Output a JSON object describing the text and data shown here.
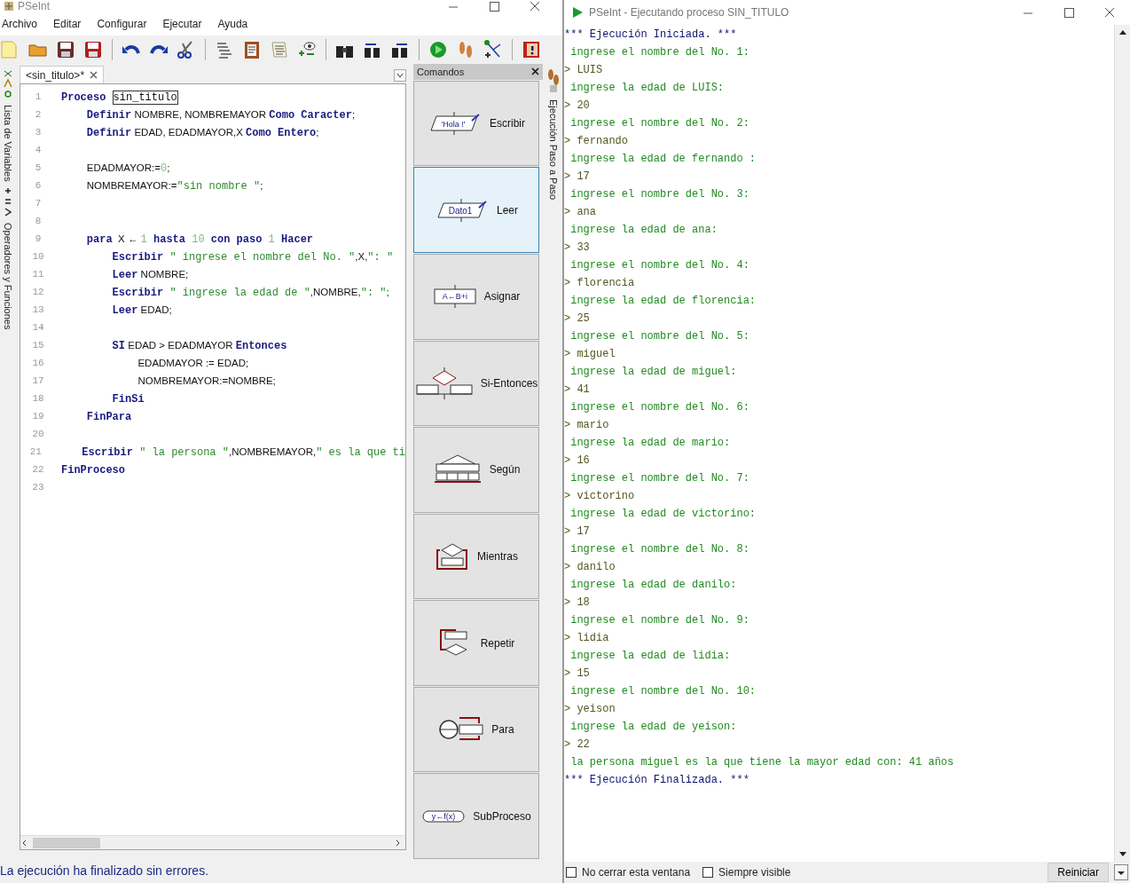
{
  "editor_window": {
    "title": "PSeInt",
    "menu": [
      "Archivo",
      "Editar",
      "Configurar",
      "Ejecutar",
      "Ayuda"
    ],
    "side_panel": [
      {
        "label": "Lista de Variables",
        "kind": "vars"
      },
      {
        "label": "Operadores y Funciones",
        "kind": "ops"
      }
    ],
    "tabs": [
      {
        "label": "<sin_titulo>*",
        "selected": true
      }
    ],
    "code_lines": [
      {
        "number": "1",
        "tokens": [
          {
            "text": "Proceso ",
            "kind": "kw"
          },
          {
            "text": "sin_titulo",
            "kind": "name"
          }
        ]
      },
      {
        "number": "2",
        "tokens": [
          {
            "text": "    Definir",
            "kind": "kw"
          },
          {
            "text": " NOMBRE, NOMBREMAYOR ",
            "kind": "id"
          },
          {
            "text": "Como Caracter",
            "kind": "kw"
          },
          {
            "text": ";",
            "kind": "id"
          }
        ]
      },
      {
        "number": "3",
        "tokens": [
          {
            "text": "    Definir",
            "kind": "kw"
          },
          {
            "text": " EDAD, EDADMAYOR,X ",
            "kind": "id"
          },
          {
            "text": "Como Entero",
            "kind": "kw"
          },
          {
            "text": ";",
            "kind": "id"
          }
        ]
      },
      {
        "number": "4"
      },
      {
        "number": "5",
        "tokens": [
          {
            "text": "    EDADMAYOR:=",
            "kind": "id"
          },
          {
            "text": "0",
            "kind": "num"
          },
          {
            "text": ";",
            "kind": "id"
          }
        ]
      },
      {
        "number": "6",
        "tokens": [
          {
            "text": "    NOMBREMAYOR:=",
            "kind": "id"
          },
          {
            "text": "\"sin nombre \"",
            "kind": "str"
          },
          {
            "text": ";",
            "kind": "id"
          }
        ]
      },
      {
        "number": "7"
      },
      {
        "number": "8"
      },
      {
        "number": "9",
        "tokens": [
          {
            "text": "    para",
            "kind": "kw"
          },
          {
            "text": "  X ← ",
            "kind": "id"
          },
          {
            "text": "1 ",
            "kind": "num"
          },
          {
            "text": "hasta",
            "kind": "kw"
          },
          {
            "text": " 10 ",
            "kind": "num"
          },
          {
            "text": "con paso",
            "kind": "kw"
          },
          {
            "text": " 1 ",
            "kind": "num"
          },
          {
            "text": "Hacer",
            "kind": "kw"
          }
        ]
      },
      {
        "number": "10",
        "tokens": [
          {
            "text": "        Escribir",
            "kind": "kw"
          },
          {
            "text": " \" ingrese el nombre del No. \"",
            "kind": "str"
          },
          {
            "text": ",X,",
            "kind": "id"
          },
          {
            "text": "\": \"",
            "kind": "str"
          }
        ]
      },
      {
        "number": "11",
        "tokens": [
          {
            "text": "        Leer",
            "kind": "kw"
          },
          {
            "text": " NOMBRE;",
            "kind": "id"
          }
        ]
      },
      {
        "number": "12",
        "tokens": [
          {
            "text": "        Escribir",
            "kind": "kw"
          },
          {
            "text": " \" ingrese la edad de \"",
            "kind": "str"
          },
          {
            "text": ",NOMBRE,",
            "kind": "id"
          },
          {
            "text": "\": \"",
            "kind": "str"
          },
          {
            "text": ";",
            "kind": "id"
          }
        ]
      },
      {
        "number": "13",
        "tokens": [
          {
            "text": "        Leer",
            "kind": "kw"
          },
          {
            "text": " EDAD;",
            "kind": "id"
          }
        ]
      },
      {
        "number": "14"
      },
      {
        "number": "15",
        "tokens": [
          {
            "text": "        SI",
            "kind": "kw"
          },
          {
            "text": " EDAD > EDADMAYOR ",
            "kind": "id"
          },
          {
            "text": "Entonces",
            "kind": "kw"
          }
        ]
      },
      {
        "number": "16",
        "tokens": [
          {
            "text": "            EDADMAYOR := EDAD;",
            "kind": "id"
          }
        ]
      },
      {
        "number": "17",
        "tokens": [
          {
            "text": "            NOMBREMAYOR:=NOMBRE;",
            "kind": "id"
          }
        ]
      },
      {
        "number": "18",
        "tokens": [
          {
            "text": "        FinSi",
            "kind": "kw"
          }
        ]
      },
      {
        "number": "19",
        "tokens": [
          {
            "text": "    FinPara",
            "kind": "kw"
          }
        ]
      },
      {
        "number": "20"
      },
      {
        "number": "21",
        "tokens": [
          {
            "text": "    Escribir",
            "kind": "kw"
          },
          {
            "text": " \" la persona \"",
            "kind": "str"
          },
          {
            "text": ",NOMBREMAYOR,",
            "kind": "id"
          },
          {
            "text": "\" es la que ti",
            "kind": "str"
          }
        ]
      },
      {
        "number": "22",
        "tokens": [
          {
            "text": "FinProceso",
            "kind": "kw"
          }
        ]
      },
      {
        "number": "23"
      }
    ],
    "commands": {
      "title": "Comandos",
      "items": [
        {
          "label": "Escribir",
          "kind": "out",
          "glyph": "'Hola !'",
          "selected": false
        },
        {
          "label": "Leer",
          "kind": "in",
          "glyph": "Dato1",
          "selected": true
        },
        {
          "label": "Asignar",
          "kind": "assign",
          "glyph": "A←B+i",
          "selected": false
        },
        {
          "label": "Si-Entonces",
          "kind": "if",
          "selected": false
        },
        {
          "label": "Según",
          "kind": "switch",
          "selected": false
        },
        {
          "label": "Mientras",
          "kind": "while",
          "selected": false
        },
        {
          "label": "Repetir",
          "kind": "repeat",
          "selected": false
        },
        {
          "label": "Para",
          "kind": "for",
          "selected": false
        },
        {
          "label": "SubProceso",
          "kind": "sub",
          "glyph": "y←f(x)",
          "selected": false
        }
      ]
    },
    "step_panel": {
      "label": "Ejecución Paso a Paso"
    },
    "status": "La ejecución ha finalizado sin errores."
  },
  "run_window": {
    "title": "PSeInt - Ejecutando proceso SIN_TITULO",
    "console": [
      {
        "text": "*** Ejecución Iniciada. ***",
        "kind": "system"
      },
      {
        "text": " ingrese el nombre del No. 1:",
        "kind": "output"
      },
      {
        "text": "> LUIS",
        "kind": "input"
      },
      {
        "text": " ingrese la edad de LUIS:",
        "kind": "output"
      },
      {
        "text": "> 20",
        "kind": "input"
      },
      {
        "text": " ingrese el nombre del No. 2:",
        "kind": "output"
      },
      {
        "text": "> fernando",
        "kind": "input"
      },
      {
        "text": " ingrese la edad de fernando :",
        "kind": "output"
      },
      {
        "text": "> 17",
        "kind": "input"
      },
      {
        "text": " ingrese el nombre del No. 3:",
        "kind": "output"
      },
      {
        "text": "> ana",
        "kind": "input"
      },
      {
        "text": " ingrese la edad de ana:",
        "kind": "output"
      },
      {
        "text": "> 33",
        "kind": "input"
      },
      {
        "text": " ingrese el nombre del No. 4:",
        "kind": "output"
      },
      {
        "text": "> florencia",
        "kind": "input"
      },
      {
        "text": " ingrese la edad de florencia:",
        "kind": "output"
      },
      {
        "text": "> 25",
        "kind": "input"
      },
      {
        "text": " ingrese el nombre del No. 5:",
        "kind": "output"
      },
      {
        "text": "> miguel",
        "kind": "input"
      },
      {
        "text": " ingrese la edad de miguel:",
        "kind": "output"
      },
      {
        "text": "> 41",
        "kind": "input"
      },
      {
        "text": " ingrese el nombre del No. 6:",
        "kind": "output"
      },
      {
        "text": "> mario",
        "kind": "input"
      },
      {
        "text": " ingrese la edad de mario:",
        "kind": "output"
      },
      {
        "text": "> 16",
        "kind": "input"
      },
      {
        "text": " ingrese el nombre del No. 7:",
        "kind": "output"
      },
      {
        "text": "> victorino",
        "kind": "input"
      },
      {
        "text": " ingrese la edad de victorino:",
        "kind": "output"
      },
      {
        "text": "> 17",
        "kind": "input"
      },
      {
        "text": " ingrese el nombre del No. 8:",
        "kind": "output"
      },
      {
        "text": "> danilo",
        "kind": "input"
      },
      {
        "text": " ingrese la edad de danilo:",
        "kind": "output"
      },
      {
        "text": "> 18",
        "kind": "input"
      },
      {
        "text": " ingrese el nombre del No. 9:",
        "kind": "output"
      },
      {
        "text": "> lidia",
        "kind": "input"
      },
      {
        "text": " ingrese la edad de lidia:",
        "kind": "output"
      },
      {
        "text": "> 15",
        "kind": "input"
      },
      {
        "text": " ingrese el nombre del No. 10:",
        "kind": "output"
      },
      {
        "text": "> yeison",
        "kind": "input"
      },
      {
        "text": " ingrese la edad de yeison:",
        "kind": "output"
      },
      {
        "text": "> 22",
        "kind": "input"
      },
      {
        "text": " la persona miguel es la que tiene la mayor edad con: 41 años",
        "kind": "output"
      },
      {
        "text": "*** Ejecución Finalizada. ***",
        "kind": "system"
      }
    ],
    "options": [
      {
        "label": "No cerrar esta ventana",
        "checked": false
      },
      {
        "label": "Siempre visible",
        "checked": false
      }
    ],
    "restart_button": "Reiniciar"
  }
}
